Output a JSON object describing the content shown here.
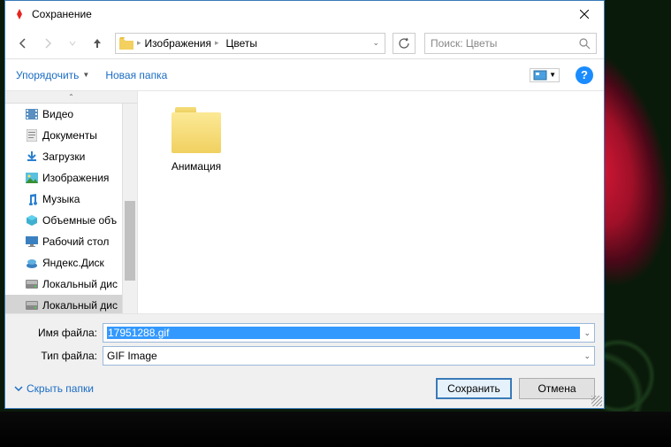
{
  "title": "Сохранение",
  "breadcrumb": {
    "seg1": "Изображения",
    "seg2": "Цветы"
  },
  "search": {
    "placeholder": "Поиск: Цветы"
  },
  "toolbar": {
    "organize": "Упорядочить",
    "newfolder": "Новая папка"
  },
  "sidebar": {
    "items": [
      {
        "label": "Видео",
        "icon": "video"
      },
      {
        "label": "Документы",
        "icon": "doc"
      },
      {
        "label": "Загрузки",
        "icon": "download"
      },
      {
        "label": "Изображения",
        "icon": "pictures"
      },
      {
        "label": "Музыка",
        "icon": "music"
      },
      {
        "label": "Объемные объ",
        "icon": "3d"
      },
      {
        "label": "Рабочий стол",
        "icon": "desktop"
      },
      {
        "label": "Яндекс.Диск",
        "icon": "yadisk"
      },
      {
        "label": "Локальный дис",
        "icon": "drive"
      },
      {
        "label": "Локальный дис",
        "icon": "drive",
        "selected": true
      }
    ]
  },
  "content": {
    "items": [
      {
        "name": "Анимация",
        "type": "folder"
      }
    ]
  },
  "filename": {
    "label": "Имя файла:",
    "value": "17951288.gif"
  },
  "filetype": {
    "label": "Тип файла:",
    "value": "GIF Image"
  },
  "buttons": {
    "hide": "Скрыть папки",
    "save": "Сохранить",
    "cancel": "Отмена"
  }
}
